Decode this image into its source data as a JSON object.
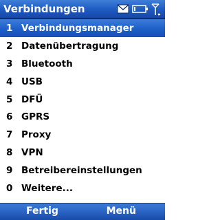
{
  "window": {
    "title": "Verbindungen"
  },
  "status_icons": [
    "mail-icon",
    "battery-icon",
    "signal-icon"
  ],
  "menu": {
    "items": [
      {
        "num": "1",
        "label": "Verbindungsmanager",
        "selected": true
      },
      {
        "num": "2",
        "label": "Datenübertragung"
      },
      {
        "num": "3",
        "label": "Bluetooth"
      },
      {
        "num": "4",
        "label": "USB"
      },
      {
        "num": "5",
        "label": "DFÜ"
      },
      {
        "num": "6",
        "label": "GPRS"
      },
      {
        "num": "7",
        "label": "Proxy"
      },
      {
        "num": "8",
        "label": "VPN"
      },
      {
        "num": "9",
        "label": "Betreibereinstellungen"
      },
      {
        "num": "0",
        "label": "Weitere..."
      }
    ]
  },
  "softkeys": {
    "left": "Fertig",
    "right": "Menü"
  },
  "colors": {
    "accent": "#1f5cc3",
    "selected_text": "#ffffff"
  }
}
